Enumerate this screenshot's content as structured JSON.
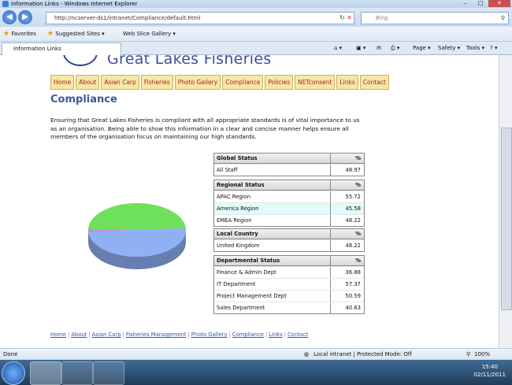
{
  "window": {
    "title": "Information Links - Windows Internet Explorer"
  },
  "address": {
    "url": "http://ncserver-ds1/intranet/Compliance/default.html",
    "search_placeholder": "Bing"
  },
  "favorites": {
    "label": "Favorites",
    "suggested": "Suggested Sites ▾",
    "slice": "Web Slice Gallery ▾"
  },
  "tab": {
    "label": "Information Links"
  },
  "commandbar": {
    "page": "Page ▾",
    "safety": "Safety ▾",
    "tools": "Tools ▾"
  },
  "site": {
    "brand": "Great Lakes Fisheries",
    "nav": [
      "Home",
      "About",
      "Asian Carp",
      "Fisheries",
      "Photo Gallery",
      "Compliance",
      "Policies",
      "NETconsent",
      "Links",
      "Contact"
    ],
    "page_title": "Compliance",
    "intro": "Ensuring that Great Lakes Fisheries is compliant with all appropriate standards is of vital importance to us as an organisation. Being able to show this information in a clear and concise manner helps ensure all members of the organisation focus on maintaining our high standards."
  },
  "tables": [
    {
      "title": "Global Status",
      "pct": "%",
      "rows": [
        {
          "name": "All Staff",
          "value": "48.97"
        }
      ]
    },
    {
      "title": "Regional Status",
      "pct": "%",
      "rows": [
        {
          "name": "APAC Region",
          "value": "55.72"
        },
        {
          "name": "America Region",
          "value": "45.58",
          "highlight": true
        },
        {
          "name": "EMEA Region",
          "value": "48.22"
        }
      ]
    },
    {
      "title": "Local Country",
      "pct": "%",
      "rows": [
        {
          "name": "United Kingdom",
          "value": "48.22"
        }
      ]
    },
    {
      "title": "Departmental Status",
      "pct": "%",
      "rows": [
        {
          "name": "Finance & Admin Dept",
          "value": "36.88"
        },
        {
          "name": "IT Department",
          "value": "57.37"
        },
        {
          "name": "Project Management Dept",
          "value": "50.59"
        },
        {
          "name": "Sales Department",
          "value": "40.63"
        }
      ]
    }
  ],
  "chart_data": {
    "type": "pie",
    "slices": [
      {
        "value": 48.97,
        "color": "#6ee05a"
      },
      {
        "value": 49.53,
        "color": "#8fb0f5"
      },
      {
        "value": 1.5,
        "color": "#c08ae0"
      }
    ]
  },
  "footer_links": [
    "Home",
    "About",
    "Asian Carp",
    "Fisheries Management",
    "Photo Gallery",
    "Compliance",
    "Links",
    "Contact"
  ],
  "status": {
    "left": "Done",
    "zone": "Local intranet | Protected Mode: Off",
    "zoom": "100%"
  },
  "clock": {
    "time": "15:40",
    "date": "02/11/2011"
  }
}
